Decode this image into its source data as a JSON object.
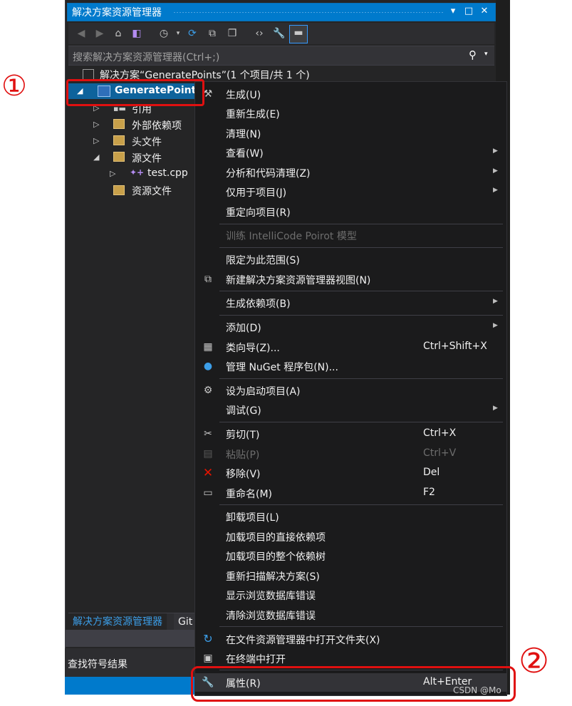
{
  "window": {
    "title": "解决方案资源管理器",
    "buttons": {
      "dropdown": "▾",
      "maximize": "□",
      "close": "✕"
    }
  },
  "search": {
    "placeholder": "搜索解决方案资源管理器(Ctrl+;)"
  },
  "tree": {
    "solution": "解决方案“GeneratePoints”(1 个项目/共 1 个)",
    "project": "GeneratePoint",
    "items": [
      {
        "label": "引用"
      },
      {
        "label": "外部依赖项"
      },
      {
        "label": "头文件"
      },
      {
        "label": "源文件"
      },
      {
        "label": "test.cpp"
      },
      {
        "label": "资源文件"
      }
    ]
  },
  "bottom_tabs": {
    "solution_explorer": "解决方案资源管理器",
    "git": "Git"
  },
  "find_symbol": "查找符号结果",
  "menu": {
    "items": [
      {
        "label": "生成(U)"
      },
      {
        "label": "重新生成(E)"
      },
      {
        "label": "清理(N)"
      },
      {
        "label": "查看(W)"
      },
      {
        "label": "分析和代码清理(Z)"
      },
      {
        "label": "仅用于项目(J)"
      },
      {
        "label": "重定向项目(R)"
      },
      {
        "label": "训练 IntelliCode Poirot 模型"
      },
      {
        "label": "限定为此范围(S)"
      },
      {
        "label": "新建解决方案资源管理器视图(N)"
      },
      {
        "label": "生成依赖项(B)"
      },
      {
        "label": "添加(D)"
      },
      {
        "label": "类向导(Z)...",
        "shortcut": "Ctrl+Shift+X"
      },
      {
        "label": "管理 NuGet 程序包(N)..."
      },
      {
        "label": "设为启动项目(A)"
      },
      {
        "label": "调试(G)"
      },
      {
        "label": "剪切(T)",
        "shortcut": "Ctrl+X"
      },
      {
        "label": "粘贴(P)",
        "shortcut": "Ctrl+V"
      },
      {
        "label": "移除(V)",
        "shortcut": "Del"
      },
      {
        "label": "重命名(M)",
        "shortcut": "F2"
      },
      {
        "label": "卸载项目(L)"
      },
      {
        "label": "加载项目的直接依赖项"
      },
      {
        "label": "加载项目的整个依赖树"
      },
      {
        "label": "重新扫描解决方案(S)"
      },
      {
        "label": "显示浏览数据库错误"
      },
      {
        "label": "清除浏览数据库错误"
      },
      {
        "label": "在文件资源管理器中打开文件夹(X)"
      },
      {
        "label": "在终端中打开"
      },
      {
        "label": "属性(R)",
        "shortcut": "Alt+Enter"
      }
    ]
  },
  "annotations": {
    "one": "①",
    "two": "②"
  },
  "watermark": "CSDN @Mo",
  "colors": {
    "accent": "#007acc",
    "menu_bg": "#1b1b1c",
    "panel_bg": "#252526",
    "annotation": "#e01010"
  }
}
